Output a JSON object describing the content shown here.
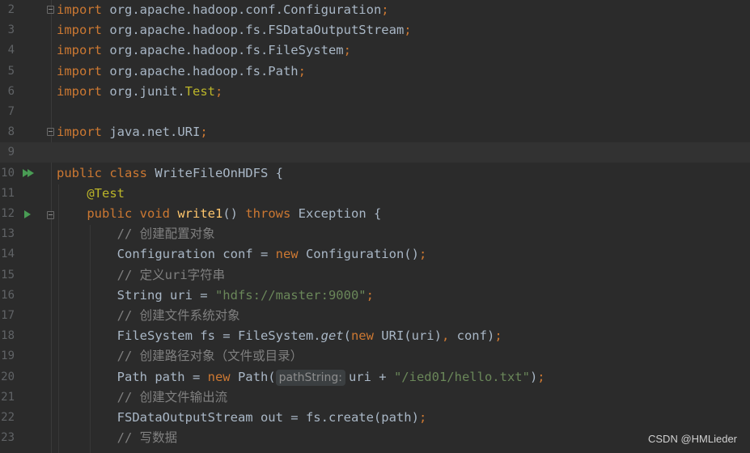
{
  "editor": {
    "lines": [
      {
        "n": "2",
        "parts": [
          {
            "t": "import",
            "c": "kw"
          },
          {
            "t": " org.apache.hadoop.conf.Configuration"
          },
          {
            "t": ";",
            "c": "kw"
          }
        ]
      },
      {
        "n": "3",
        "parts": [
          {
            "t": "import",
            "c": "kw"
          },
          {
            "t": " org.apache.hadoop.fs.FSDataOutputStream"
          },
          {
            "t": ";",
            "c": "kw"
          }
        ]
      },
      {
        "n": "4",
        "parts": [
          {
            "t": "import",
            "c": "kw"
          },
          {
            "t": " org.apache.hadoop.fs.FileSystem"
          },
          {
            "t": ";",
            "c": "kw"
          }
        ]
      },
      {
        "n": "5",
        "parts": [
          {
            "t": "import",
            "c": "kw"
          },
          {
            "t": " org.apache.hadoop.fs.Path"
          },
          {
            "t": ";",
            "c": "kw"
          }
        ]
      },
      {
        "n": "6",
        "parts": [
          {
            "t": "import",
            "c": "kw"
          },
          {
            "t": " org.junit."
          },
          {
            "t": "Test",
            "c": "ann"
          },
          {
            "t": ";",
            "c": "kw"
          }
        ]
      },
      {
        "n": "7",
        "parts": []
      },
      {
        "n": "8",
        "parts": [
          {
            "t": "import",
            "c": "kw"
          },
          {
            "t": " java.net.URI"
          },
          {
            "t": ";",
            "c": "kw"
          }
        ]
      },
      {
        "n": "9",
        "parts": [],
        "current": true
      },
      {
        "n": "10",
        "parts": [
          {
            "t": "public class",
            "c": "kw"
          },
          {
            "t": " WriteFileOnHDFS {"
          }
        ]
      },
      {
        "n": "11",
        "parts": [
          {
            "t": "    "
          },
          {
            "t": "@Test",
            "c": "ann"
          }
        ]
      },
      {
        "n": "12",
        "parts": [
          {
            "t": "    "
          },
          {
            "t": "public void",
            "c": "kw"
          },
          {
            "t": " "
          },
          {
            "t": "write1",
            "c": "fn"
          },
          {
            "t": "() "
          },
          {
            "t": "throws",
            "c": "kw"
          },
          {
            "t": " Exception {"
          }
        ]
      },
      {
        "n": "13",
        "parts": [
          {
            "t": "        "
          },
          {
            "t": "// 创建配置对象",
            "c": "cm"
          }
        ]
      },
      {
        "n": "14",
        "parts": [
          {
            "t": "        Configuration conf = "
          },
          {
            "t": "new",
            "c": "kw"
          },
          {
            "t": " Configuration()"
          },
          {
            "t": ";",
            "c": "kw"
          }
        ]
      },
      {
        "n": "15",
        "parts": [
          {
            "t": "        "
          },
          {
            "t": "// 定义uri字符串",
            "c": "cm"
          }
        ]
      },
      {
        "n": "16",
        "parts": [
          {
            "t": "        String uri = "
          },
          {
            "t": "\"hdfs://master:9000\"",
            "c": "str"
          },
          {
            "t": ";",
            "c": "kw"
          }
        ]
      },
      {
        "n": "17",
        "parts": [
          {
            "t": "        "
          },
          {
            "t": "// 创建文件系统对象",
            "c": "cm"
          }
        ]
      },
      {
        "n": "18",
        "parts": [
          {
            "t": "        FileSystem fs = FileSystem."
          },
          {
            "t": "get",
            "c": "it"
          },
          {
            "t": "("
          },
          {
            "t": "new",
            "c": "kw"
          },
          {
            "t": " URI(uri)"
          },
          {
            "t": ",",
            "c": "kw"
          },
          {
            "t": " conf)"
          },
          {
            "t": ";",
            "c": "kw"
          }
        ]
      },
      {
        "n": "19",
        "parts": [
          {
            "t": "        "
          },
          {
            "t": "// 创建路径对象（文件或目录）",
            "c": "cm"
          }
        ]
      },
      {
        "n": "20",
        "parts": [
          {
            "t": "        Path path = "
          },
          {
            "t": "new",
            "c": "kw"
          },
          {
            "t": " Path("
          },
          {
            "t": "pathString:",
            "c": "hint"
          },
          {
            "t": "uri + "
          },
          {
            "t": "\"/ied01/hello.txt\"",
            "c": "str"
          },
          {
            "t": ")"
          },
          {
            "t": ";",
            "c": "kw"
          }
        ]
      },
      {
        "n": "21",
        "parts": [
          {
            "t": "        "
          },
          {
            "t": "// 创建文件输出流",
            "c": "cm"
          }
        ]
      },
      {
        "n": "22",
        "parts": [
          {
            "t": "        FSDataOutputStream out = fs.create(path)"
          },
          {
            "t": ";",
            "c": "kw"
          }
        ]
      },
      {
        "n": "23",
        "parts": [
          {
            "t": "        "
          },
          {
            "t": "// 写数据",
            "c": "cm"
          }
        ]
      }
    ]
  },
  "watermark": "CSDN @HMLieder",
  "icons": {
    "run_class": "run-double-icon",
    "run_method": "run-icon",
    "fold": "fold-icon"
  }
}
